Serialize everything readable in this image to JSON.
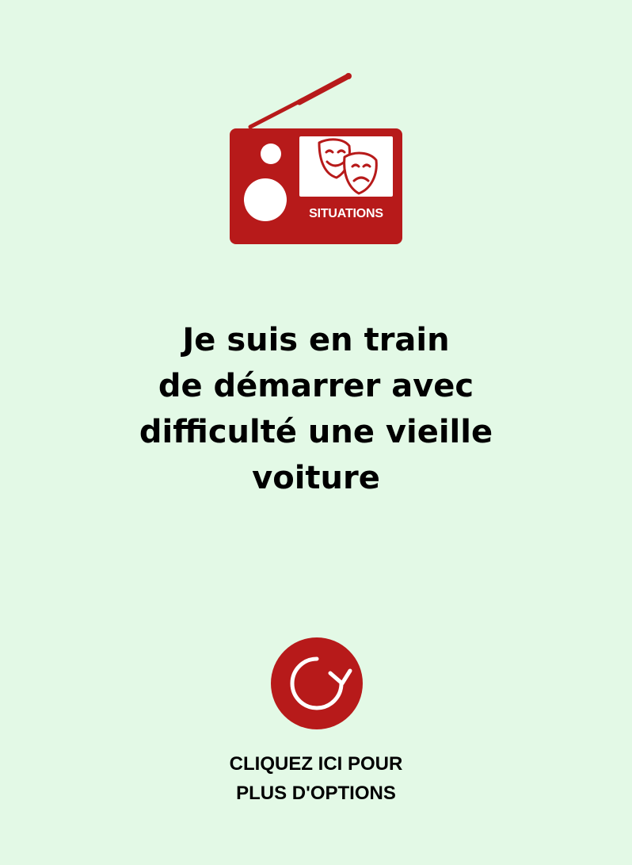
{
  "brand": {
    "logo_icon": "radio-icon",
    "badge_icon": "theater-masks-icon",
    "label": "SITUATIONS",
    "accent_color": "#b71a1a",
    "background_color": "#e3f9e6"
  },
  "message": {
    "lines": [
      "Je suis en train",
      "de démarrer avec",
      "difficulté une vieille",
      "voiture"
    ]
  },
  "action": {
    "icon": "refresh-icon",
    "lines": [
      "CLIQUEZ ICI POUR",
      "PLUS D'OPTIONS"
    ]
  }
}
